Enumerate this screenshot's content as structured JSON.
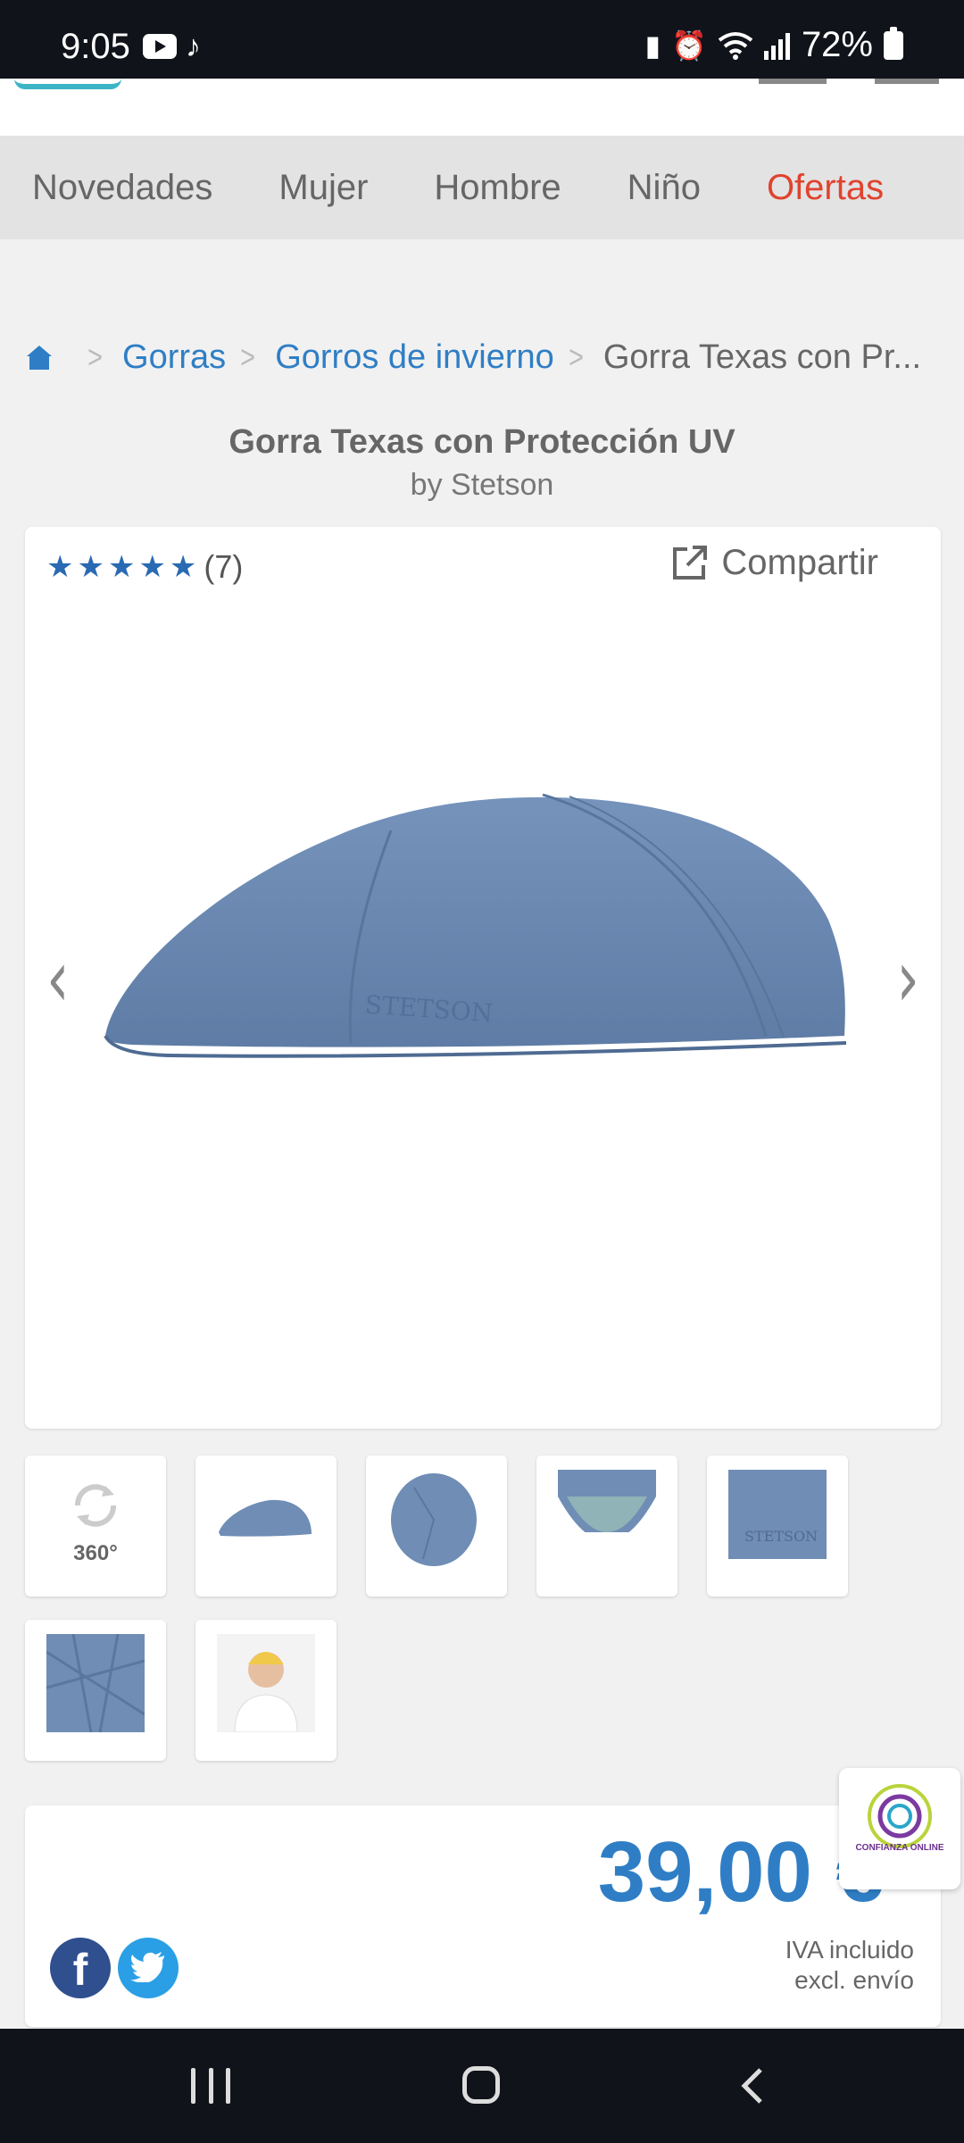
{
  "status_bar": {
    "time": "9:05",
    "battery": "72%",
    "left_icons": [
      "youtube-icon",
      "tiktok-icon"
    ],
    "right_icons": [
      "battery-saver-icon",
      "alarm-icon",
      "wifi-icon",
      "signal-icon",
      "battery-icon"
    ]
  },
  "category_nav": {
    "items": [
      {
        "label": "Novedades"
      },
      {
        "label": "Mujer"
      },
      {
        "label": "Hombre"
      },
      {
        "label": "Niño"
      },
      {
        "label": "Ofertas",
        "color": "#e0432f"
      }
    ]
  },
  "breadcrumb": {
    "home_icon": "home-icon",
    "items": [
      "Gorras",
      "Gorros de invierno"
    ],
    "current": "Gorra Texas con Pr..."
  },
  "product": {
    "title": "Gorra Texas con Protección UV",
    "brand": "by Stetson",
    "rating": {
      "stars": 5,
      "count": "(7)"
    },
    "share_label": "Compartir",
    "image_alt": "blue flat cap",
    "hat_color": "#6f8db5",
    "accent_color": "#2f7ec5"
  },
  "thumbnails": {
    "spin_label": "360°",
    "items": [
      "360-view",
      "side-view",
      "top-view",
      "inner-view",
      "logo-detail",
      "fabric-detail",
      "model-photo"
    ]
  },
  "price": {
    "amount": "39,00 €",
    "tax_note": "IVA incluido",
    "shipping_note": "excl. envío"
  },
  "social": {
    "facebook_label": "f",
    "twitter_icon": "twitter-icon"
  },
  "trust_badge": {
    "label": "CONFIANZA ONLINE"
  },
  "system_nav": {
    "buttons": [
      "recent-apps",
      "home",
      "back"
    ]
  }
}
